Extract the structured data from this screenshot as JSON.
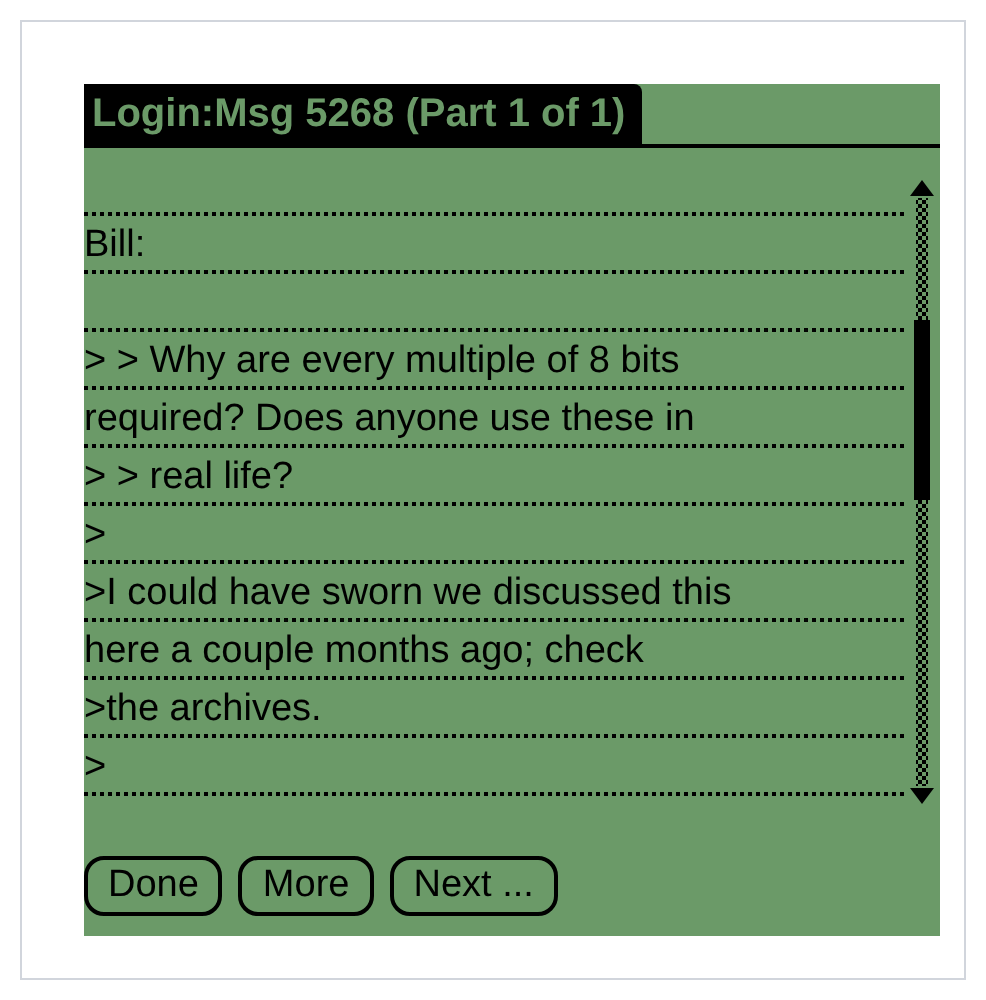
{
  "title": "Login:Msg 5268 (Part 1 of 1)",
  "lines": [
    {
      "kind": "text",
      "text": "Bill:"
    },
    {
      "kind": "blank"
    },
    {
      "kind": "text",
      "text": "> > Why are every multiple of 8 bits"
    },
    {
      "kind": "text",
      "text": "required? Does anyone use these in"
    },
    {
      "kind": "text",
      "text": "> > real life?"
    },
    {
      "kind": "text",
      "text": ">"
    },
    {
      "kind": "text",
      "text": ">I could have sworn we discussed this"
    },
    {
      "kind": "text",
      "text": "here a couple months ago; check"
    },
    {
      "kind": "text",
      "text": ">the archives."
    },
    {
      "kind": "text",
      "text": ">"
    }
  ],
  "buttons": [
    "Done",
    "More",
    "Next ..."
  ]
}
